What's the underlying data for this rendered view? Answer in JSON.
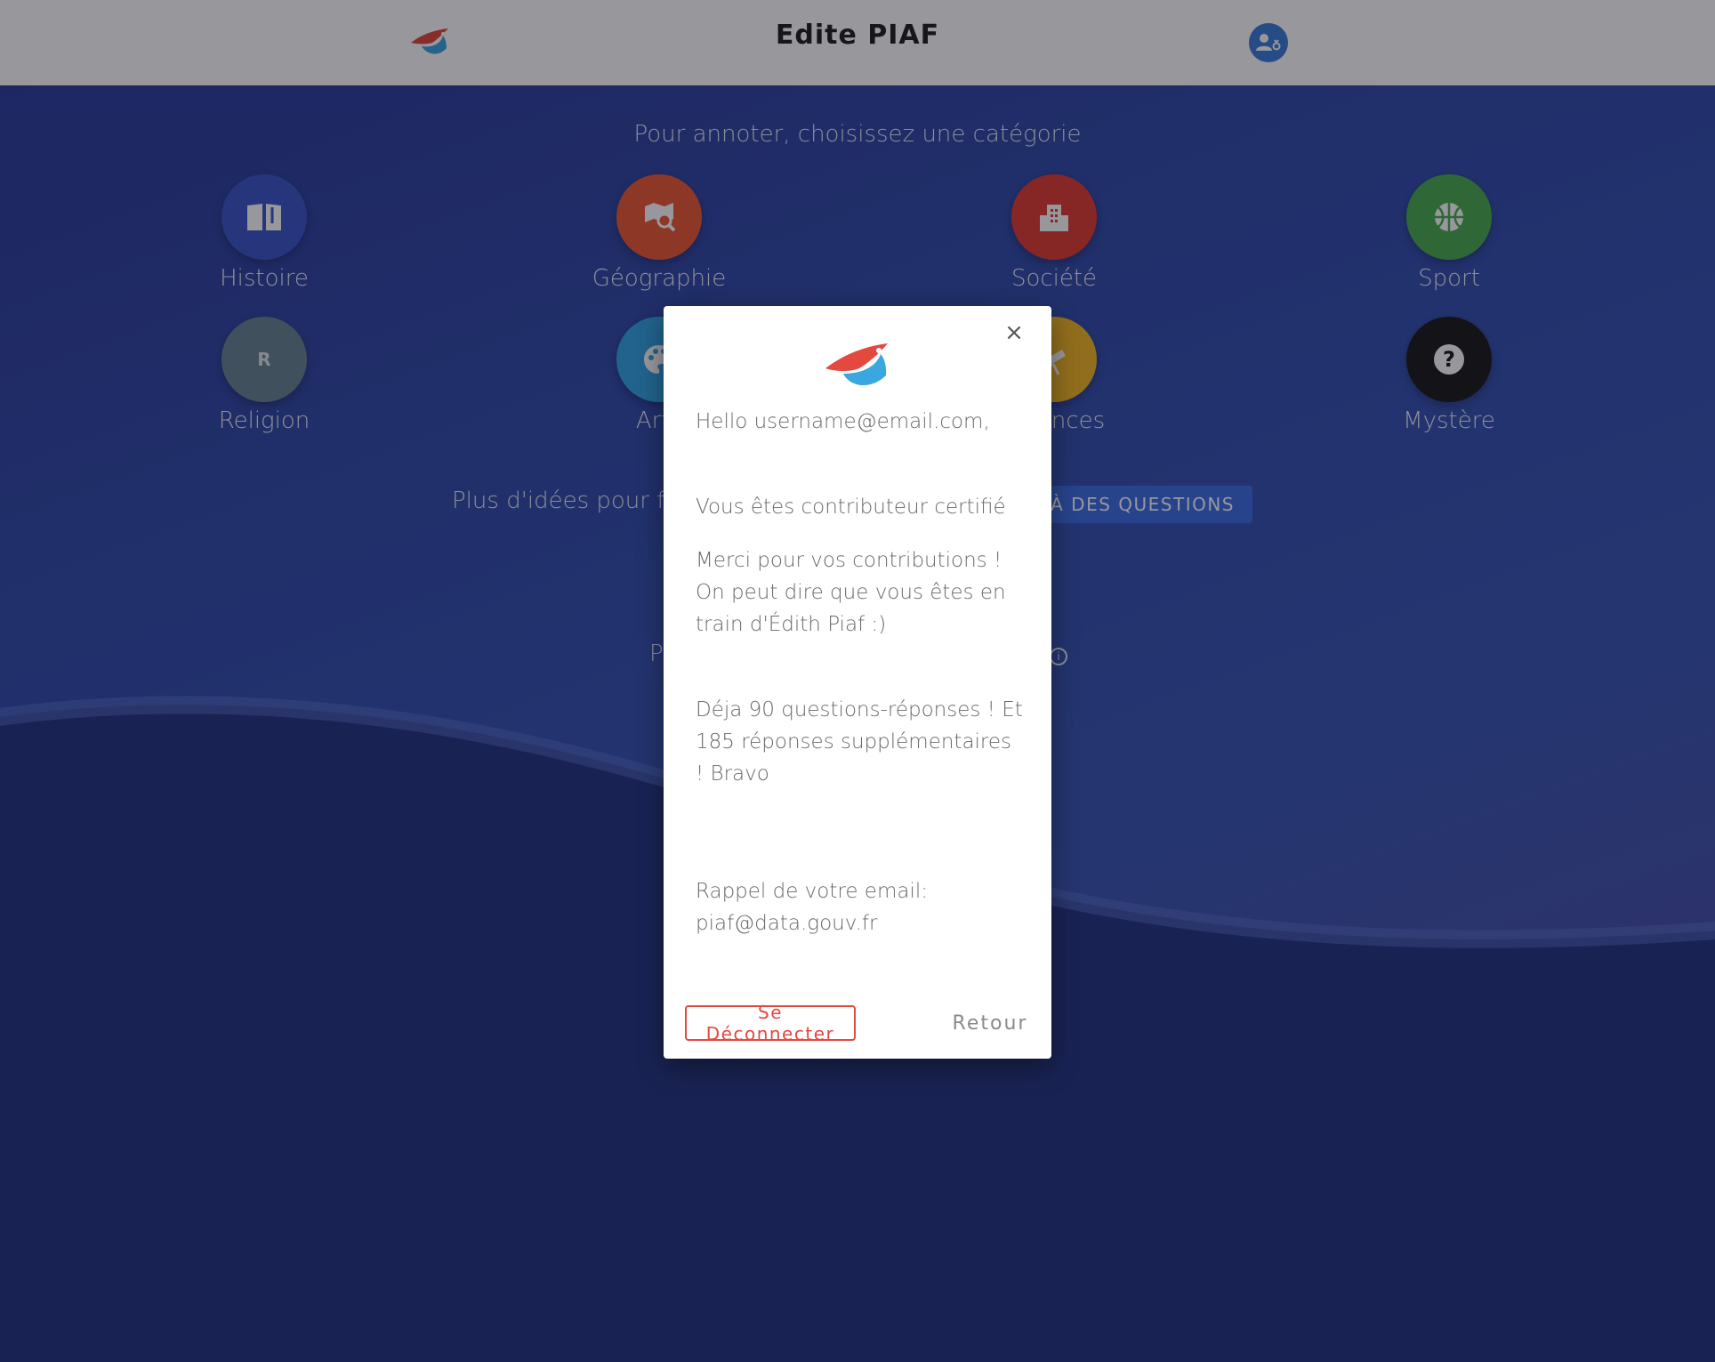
{
  "header": {
    "title": "Edite PIAF",
    "logo_icon": "piaf-bird-logo",
    "user_icon": "user-account-icon"
  },
  "main": {
    "prompt": "Pour annoter, choisissez une catégorie",
    "categories": [
      {
        "label": "Histoire",
        "icon": "book-icon",
        "color": "#3d56c9"
      },
      {
        "label": "Géographie",
        "icon": "map-search-icon",
        "color": "#ee5a35"
      },
      {
        "label": "Société",
        "icon": "city-icon",
        "color": "#e23d32"
      },
      {
        "label": "Sport",
        "icon": "basketball-icon",
        "color": "#4caf50"
      },
      {
        "label": "Religion",
        "icon": "letter-r-icon",
        "icon_text": "R",
        "color": "#6c8593"
      },
      {
        "label": "Arts",
        "icon": "palette-icon",
        "color": "#35a6e6"
      },
      {
        "label": "Sciences",
        "icon": "telescope-icon",
        "color": "#f5b825"
      },
      {
        "label": "Mystère",
        "icon": "question-icon",
        "icon_text": "?",
        "color": "#1c1c1c"
      }
    ],
    "ideas_text": "Plus d'idées pour faire",
    "ideas_button": "RE À DES QUESTIONS",
    "partial_text": "P"
  },
  "modal": {
    "greeting": "Hello username@email.com,",
    "certified": "Vous êtes contributeur certifié",
    "thanks": "Merci pour vos contributions ! On peut dire que vous êtes en train d'Édith Piaf :)",
    "stats": "Déja 90 questions-réponses ! Et 185 réponses supplémentaires ! Bravo",
    "email_reminder": "Rappel de votre email: piaf@data.gouv.fr",
    "logout_label": "Se Déconnecter",
    "back_label": "Retour"
  },
  "colors": {
    "brand_red": "#e4493f",
    "brand_blue": "#3aa7e0",
    "accent_button": "#3f6ee3"
  }
}
